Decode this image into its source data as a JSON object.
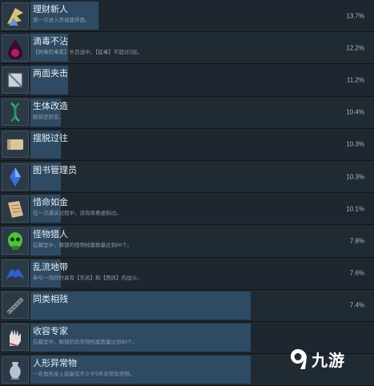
{
  "achievements": [
    {
      "title": "理财新人",
      "desc": "第一次进入存储建界面。",
      "percent": "13.7%",
      "fraction": 0.2,
      "icon": "gold-wing-icon"
    },
    {
      "title": "滴毒不沾",
      "desc": "【刷毒药毒素】头目战中，【猛毒】不超过5层。",
      "percent": "12.2%",
      "fraction": 0.11,
      "icon": "poison-drop-icon"
    },
    {
      "title": "两面夹击",
      "desc": "",
      "percent": "11.2%",
      "fraction": 0.11,
      "icon": "mirror-icon"
    },
    {
      "title": "生体改造",
      "desc": "解锁史异变。",
      "percent": "10.4%",
      "fraction": 0.09,
      "icon": "dna-icon"
    },
    {
      "title": "摆脱过往",
      "desc": "",
      "percent": "10.3%",
      "fraction": 0.09,
      "icon": "scroll-icon"
    },
    {
      "title": "图书管理员",
      "desc": "",
      "percent": "10.3%",
      "fraction": 0.09,
      "icon": "crystal-icon"
    },
    {
      "title": "惜命如金",
      "desc": "在一次通关过程中，没有命悬虚拟过。",
      "percent": "10.1%",
      "fraction": 0.09,
      "icon": "parchment-icon"
    },
    {
      "title": "怪物猎人",
      "desc": "在藏室中，解锁的怪物档案数量达到80个。",
      "percent": "7.8%",
      "fraction": 0.09,
      "icon": "green-skull-icon"
    },
    {
      "title": "乱流地带",
      "desc": "参与一场同时具有【东风】和【西风】的战斗。",
      "percent": "7.6%",
      "fraction": 0.09,
      "icon": "blue-wing-icon"
    },
    {
      "title": "同类相残",
      "desc": "",
      "percent": "7.4%",
      "fraction": 0.65,
      "icon": "chain-icon"
    },
    {
      "title": "收容专家",
      "desc": "在藏室中，解锁的异常物档案数量达到80个。",
      "percent": "",
      "fraction": 0.65,
      "icon": "glove-icon"
    },
    {
      "title": "人形异常物",
      "desc": "一名角色身上装备有不少于5件非常异常物。",
      "percent": "",
      "fraction": 0.65,
      "icon": "vase-icon"
    }
  ],
  "watermark": {
    "text": "九游",
    "logo": "9-logo-icon"
  }
}
